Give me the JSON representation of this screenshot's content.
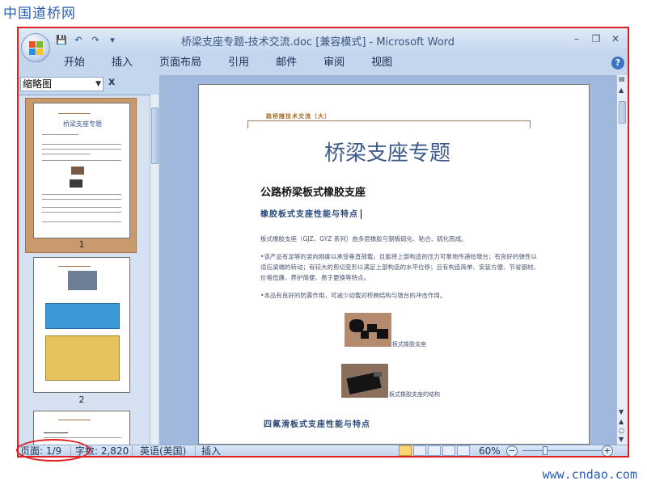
{
  "watermark": {
    "top_left": "中国道桥网",
    "bottom_right": "www.cndao.com"
  },
  "window": {
    "title": "桥梁支座专题-技术交流.doc [兼容模式] - Microsoft Word",
    "controls": {
      "minimize": "–",
      "restore": "❐",
      "close": "✕"
    }
  },
  "qat": {
    "save": "💾",
    "undo": "↶",
    "redo": "↷",
    "customize": "▾"
  },
  "ribbon": {
    "tabs": [
      {
        "label": "开始"
      },
      {
        "label": "插入"
      },
      {
        "label": "页面布局"
      },
      {
        "label": "引用"
      },
      {
        "label": "邮件"
      },
      {
        "label": "审阅"
      },
      {
        "label": "视图"
      }
    ],
    "help": "?"
  },
  "thumbnails": {
    "selector_value": "缩略图",
    "close": "x",
    "pages": [
      {
        "number": "1"
      },
      {
        "number": "2"
      }
    ],
    "page1_title": "桥梁支座专题"
  },
  "document": {
    "header_text": "路桥隧技术交流〔大〕",
    "title": "桥梁支座专题",
    "h1": "公路桥梁板式橡胶支座",
    "h2": "橡胶板式支座性能与特点",
    "p1": "板式橡胶支座（GJZ、GYZ 系列）由多层橡胶与钢板硫化、粘合、硫化而成。",
    "p2": "•该产品有足够的竖向刚度以承受垂直荷载，且能将上部构造的压力可靠地传递给墩台；有良好的弹性以适应梁端的转动；有较大的剪切变形以满足上部构造的水平位移；且有构造简单、安装方便、节省钢材、价格低廉、养护简便、易于更换等特点。",
    "p3": "•本品有良好的防震作用，可减少动载对桥跨结构与墩台的冲击作用。",
    "caption1": "板式橡胶支座",
    "caption2": "板式橡胶支座的结构",
    "h3": "四氟滑板式支座性能与特点"
  },
  "statusbar": {
    "page": "页面: 1/9",
    "words": "字数: 2,820",
    "language": "英语(美国)",
    "mode": "插入",
    "zoom": "60%",
    "zoom_level_percent": 60
  },
  "colors": {
    "frame_accent": "#e02020",
    "word_blue": "#c3d6ee"
  }
}
